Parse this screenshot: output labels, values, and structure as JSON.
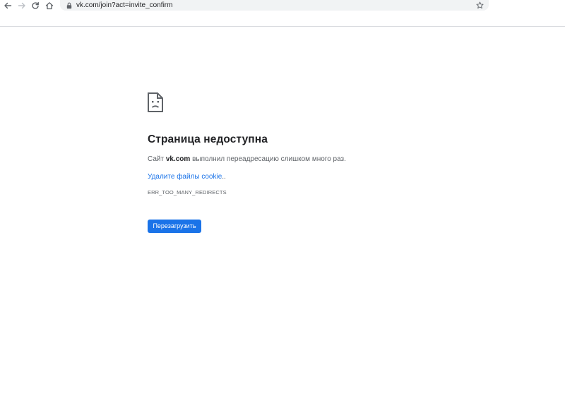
{
  "browser": {
    "url": "vk.com/join?act=invite_confirm",
    "icons": {
      "back": "arrow-left-icon",
      "forward": "arrow-right-icon",
      "reload": "reload-icon",
      "home": "home-icon",
      "lock": "lock-icon",
      "bookmark": "star-icon"
    }
  },
  "error_page": {
    "icon": "sad-page-icon",
    "title": "Страница недоступна",
    "description_prefix": "Сайт ",
    "description_domain": "vk.com",
    "description_suffix": " выполнил переадресацию слишком много раз.",
    "link_label": "Удалите файлы cookie",
    "link_ellipsis": "..",
    "error_code": "ERR_TOO_MANY_REDIRECTS",
    "reload_button_label": "Перезагрузить"
  },
  "colors": {
    "accent": "#1a73e8",
    "text_primary": "#202124",
    "text_secondary": "#5f6368",
    "omnibox_bg": "#f1f3f4"
  }
}
